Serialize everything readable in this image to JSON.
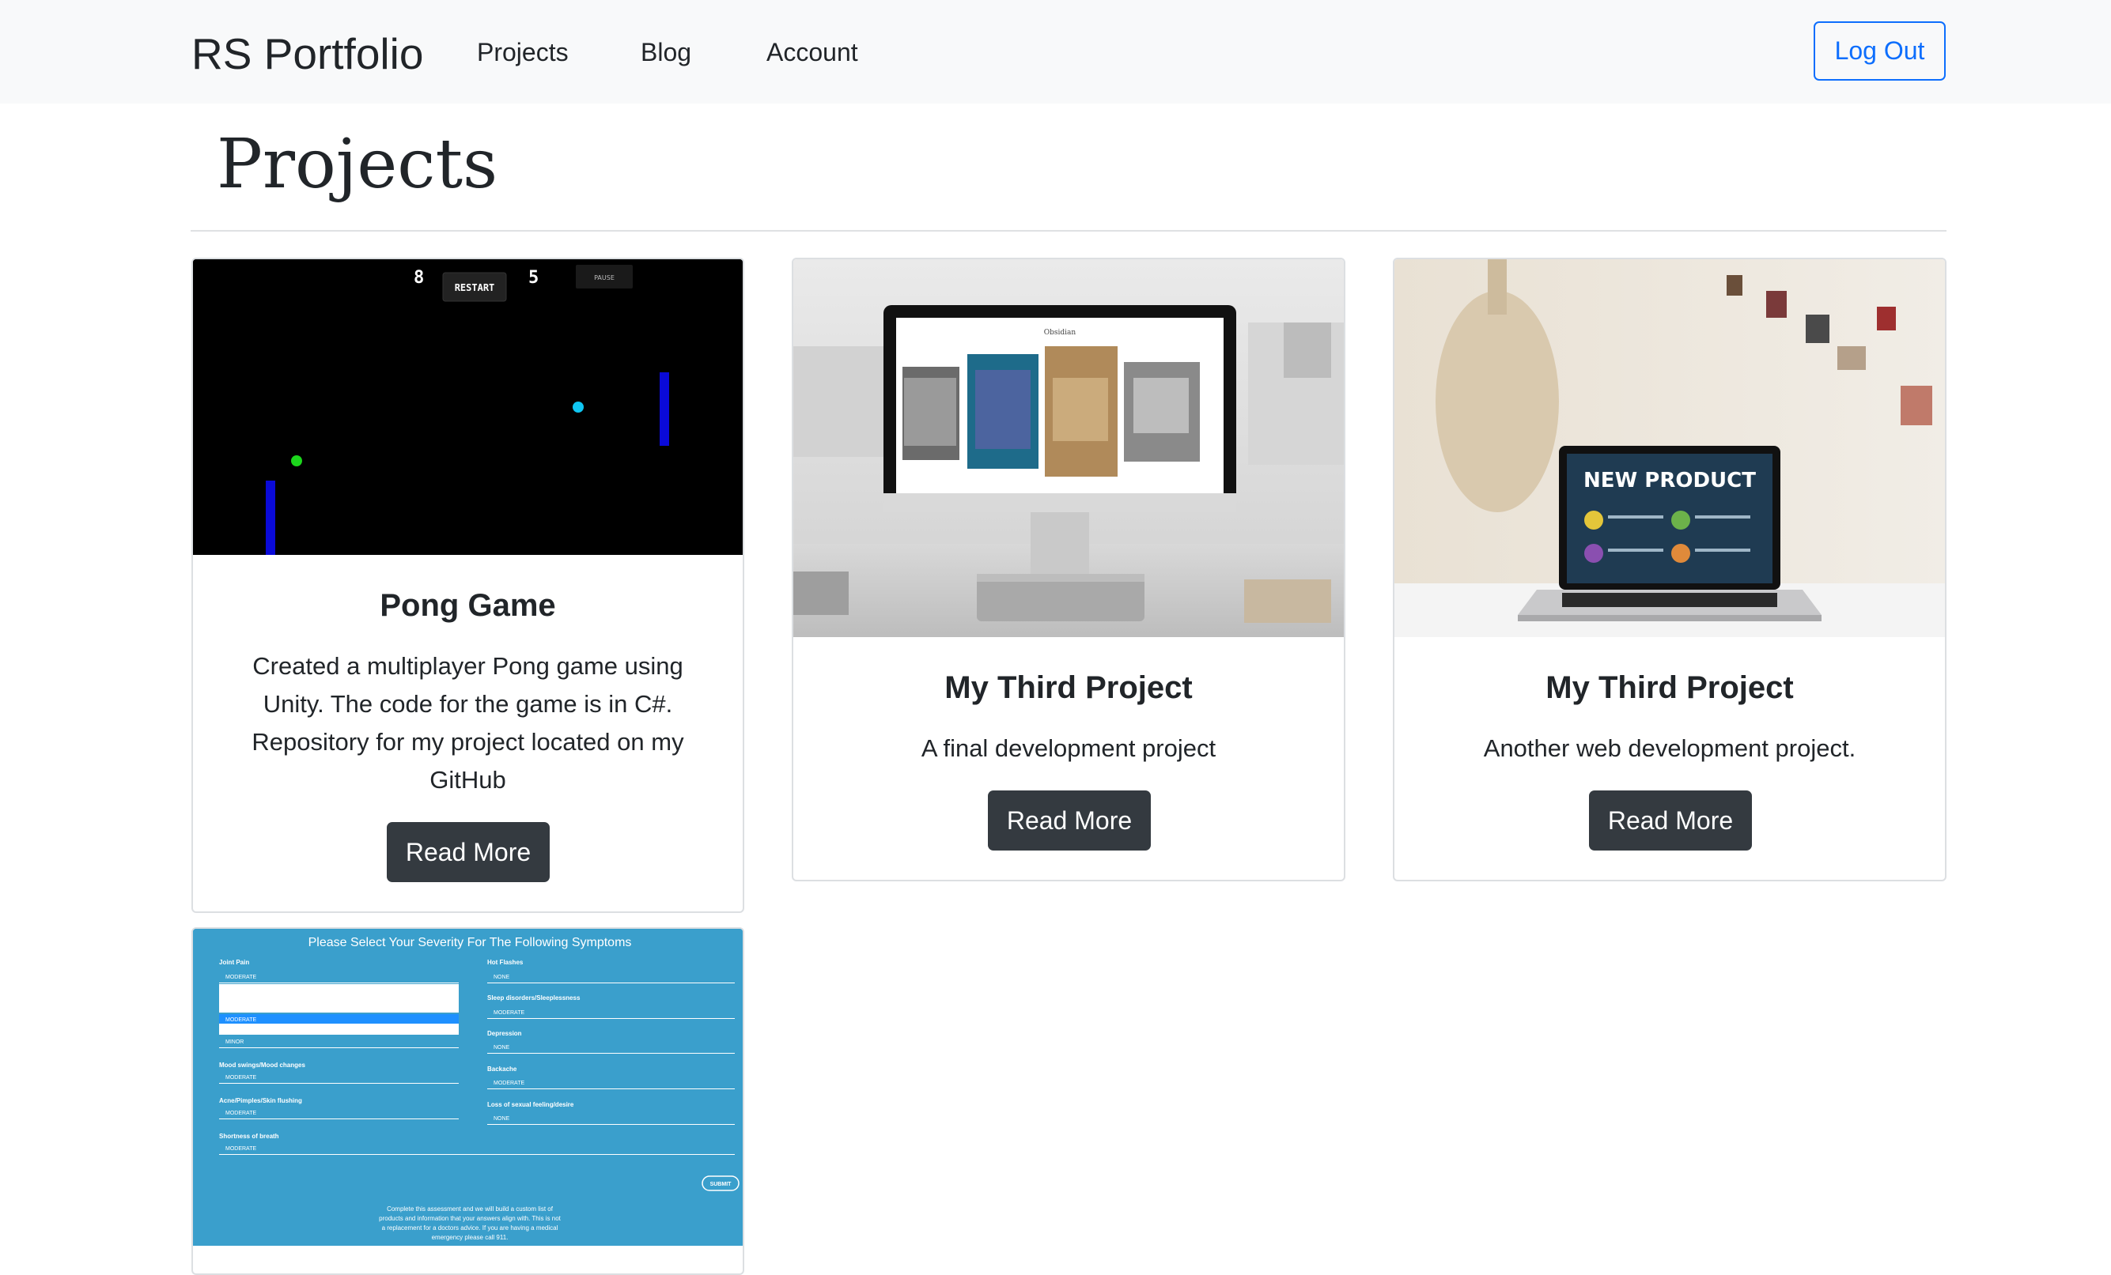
{
  "navbar": {
    "brand": "RS Portfolio",
    "links": [
      "Projects",
      "Blog",
      "Account"
    ],
    "logout_label": "Log Out"
  },
  "page": {
    "title": "Projects"
  },
  "cards": [
    {
      "title": "Pong Game",
      "text": "Created a multiplayer Pong game using Unity. The code for the game is in C#. Repository for my project located on my GitHub",
      "button": "Read More",
      "image": {
        "type": "pong-screenshot",
        "score_left": "8",
        "score_right": "5",
        "restart_label": "RESTART",
        "pause_label": "PAUSE"
      }
    },
    {
      "title": "My Third Project",
      "text": "A final development project",
      "button": "Read More",
      "image": {
        "type": "desktop-monitor-photo",
        "screen_title": "Obsidian"
      }
    },
    {
      "title": "My Third Project",
      "text": "Another web development project.",
      "button": "Read More",
      "image": {
        "type": "laptop-photo",
        "screen_title": "NEW PRODUCT"
      }
    },
    {
      "title": "",
      "text": "",
      "button": "",
      "image": {
        "type": "symptom-form-screenshot",
        "heading": "Please Select Your Severity For The Following Symptoms",
        "left_fields": [
          {
            "label": "Joint Pain",
            "value": "MODERATE"
          },
          {
            "label": "",
            "value": "MINOR"
          },
          {
            "label": "Mood swings/Mood changes",
            "value": "MODERATE"
          },
          {
            "label": "Acne/Pimples/Skin flushing",
            "value": "MODERATE"
          },
          {
            "label": "Shortness of breath",
            "value": "MODERATE"
          }
        ],
        "dropdown_option": "MODERATE",
        "right_fields": [
          {
            "label": "Hot Flashes",
            "value": "NONE"
          },
          {
            "label": "Sleep disorders/Sleeplessness",
            "value": "MODERATE"
          },
          {
            "label": "Depression",
            "value": "NONE"
          },
          {
            "label": "Backache",
            "value": "MODERATE"
          },
          {
            "label": "Loss of sexual feeling/desire",
            "value": "NONE"
          }
        ],
        "submit_label": "SUBMIT",
        "footer_lines": [
          "Complete this assessment and we will build a custom list of",
          "products and information that your answers align with. This is not",
          "a replacement for a doctors advice. If you are having a medical",
          "emergency please call 911."
        ]
      }
    }
  ],
  "colors": {
    "navbar_bg": "#f8f9fa",
    "primary": "#0d6efd",
    "button_dark": "#343a40",
    "form_blue": "#3a9fcc",
    "pong_paddle": "#0a0ad8",
    "pong_ball_green": "#1cd61c",
    "pong_ball_cyan": "#0fc6f2"
  }
}
